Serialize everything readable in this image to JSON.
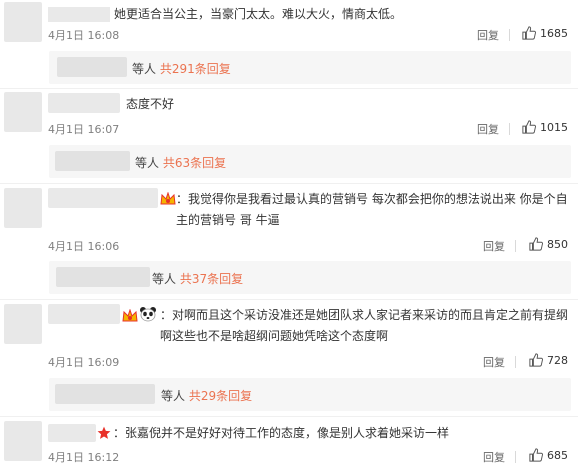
{
  "comments": [
    {
      "text": "她更适合当公主，当豪门太太。难以大火，情商太低。",
      "time": "4月1日 16:08",
      "reply_label": "回复",
      "likes": "1685",
      "sub": {
        "prefix": "等人",
        "link": "共291条回复"
      }
    },
    {
      "text": "态度不好",
      "time": "4月1日 16:07",
      "reply_label": "回复",
      "likes": "1015",
      "sub": {
        "prefix": "等人",
        "link": "共63条回复"
      }
    },
    {
      "text": "：我觉得你是我看过最认真的营销号 每次都会把你的想法说出来 你是个自主的营销号 哥 牛逼",
      "time": "4月1日 16:06",
      "reply_label": "回复",
      "likes": "850",
      "sub": {
        "prefix": "等人",
        "link": "共37条回复"
      }
    },
    {
      "text": "：对啊而且这个采访没准还是她团队求人家记者来采访的而且肯定之前有提纲啊这些也不是啥超纲问题她凭啥这个态度啊",
      "time": "4月1日 16:09",
      "reply_label": "回复",
      "likes": "728",
      "sub": {
        "prefix": "等人",
        "link": "共29条回复"
      }
    },
    {
      "text": "：张嘉倪并不是好好对待工作的态度，像是别人求着她采访一样",
      "time": "4月1日 16:12",
      "reply_label": "回复",
      "likes": "685"
    }
  ],
  "colors": {
    "link": "#eb7350",
    "badge_red": "#e8312a",
    "badge_gold": "#f5b400"
  },
  "icons": {
    "like": "thumbs-up-icon",
    "vip": "vip-crown-icon",
    "panda": "panda-icon",
    "star": "red-star-icon"
  }
}
